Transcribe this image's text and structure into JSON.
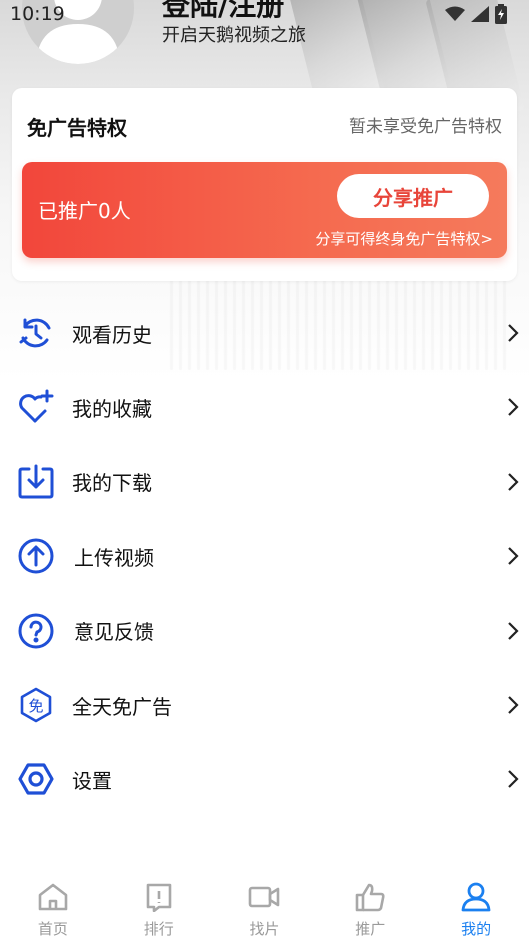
{
  "status_bar": {
    "time": "10:19"
  },
  "profile": {
    "login_title": "登陆/注册",
    "subtitle": "开启天鹅视频之旅"
  },
  "ad_free_card": {
    "title": "免广告特权",
    "status": "暂未享受免广告特权",
    "promoted_count": "已推广0人",
    "share_button": "分享推广",
    "share_tip": "分享可得终身免广告特权>"
  },
  "menu": [
    {
      "label": "观看历史",
      "icon": "history-icon"
    },
    {
      "label": "我的收藏",
      "icon": "heart-plus-icon"
    },
    {
      "label": "我的下载",
      "icon": "download-icon"
    },
    {
      "label": "上传视频",
      "icon": "upload-icon"
    },
    {
      "label": "意见反馈",
      "icon": "question-icon"
    },
    {
      "label": "全天免广告",
      "icon": "ad-free-icon"
    },
    {
      "label": "设置",
      "icon": "settings-icon"
    }
  ],
  "tabs": [
    {
      "label": "首页",
      "icon": "home-icon"
    },
    {
      "label": "排行",
      "icon": "ranking-icon"
    },
    {
      "label": "找片",
      "icon": "video-camera-icon"
    },
    {
      "label": "推广",
      "icon": "thumbs-up-icon"
    },
    {
      "label": "我的",
      "icon": "user-icon",
      "active": true
    }
  ],
  "colors": {
    "accent_blue": "#1b80f0",
    "icon_blue": "#1f4fd6",
    "promo_red": "#f2463b",
    "tab_inactive": "#9a9a9a"
  }
}
